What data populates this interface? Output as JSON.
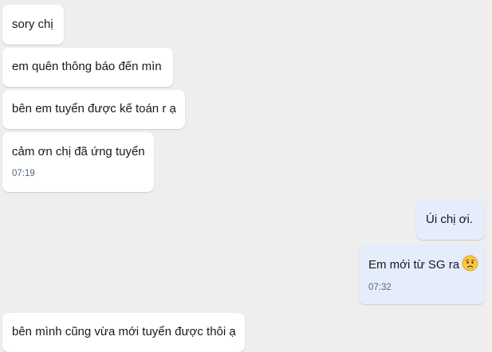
{
  "messages": [
    {
      "text": "sory chị"
    },
    {
      "text": "em quên thông báo đến mìn"
    },
    {
      "text": "bên em tuyển được kế toán r ạ"
    },
    {
      "text": "cảm ơn chị đã ứng tuyển",
      "time": "07:19"
    },
    {
      "text": "Úi chị ơi."
    },
    {
      "text": "Em mới từ SG ra",
      "emoji": "worried-face-emoji",
      "time": "07:32"
    },
    {
      "text": "bên mình cũng vừa mới tuyển được thôi ạ"
    }
  ],
  "colors": {
    "background": "#eeeeee",
    "incoming_bubble": "#ffffff",
    "outgoing_bubble": "#e5edfb",
    "timestamp": "#56677a"
  }
}
